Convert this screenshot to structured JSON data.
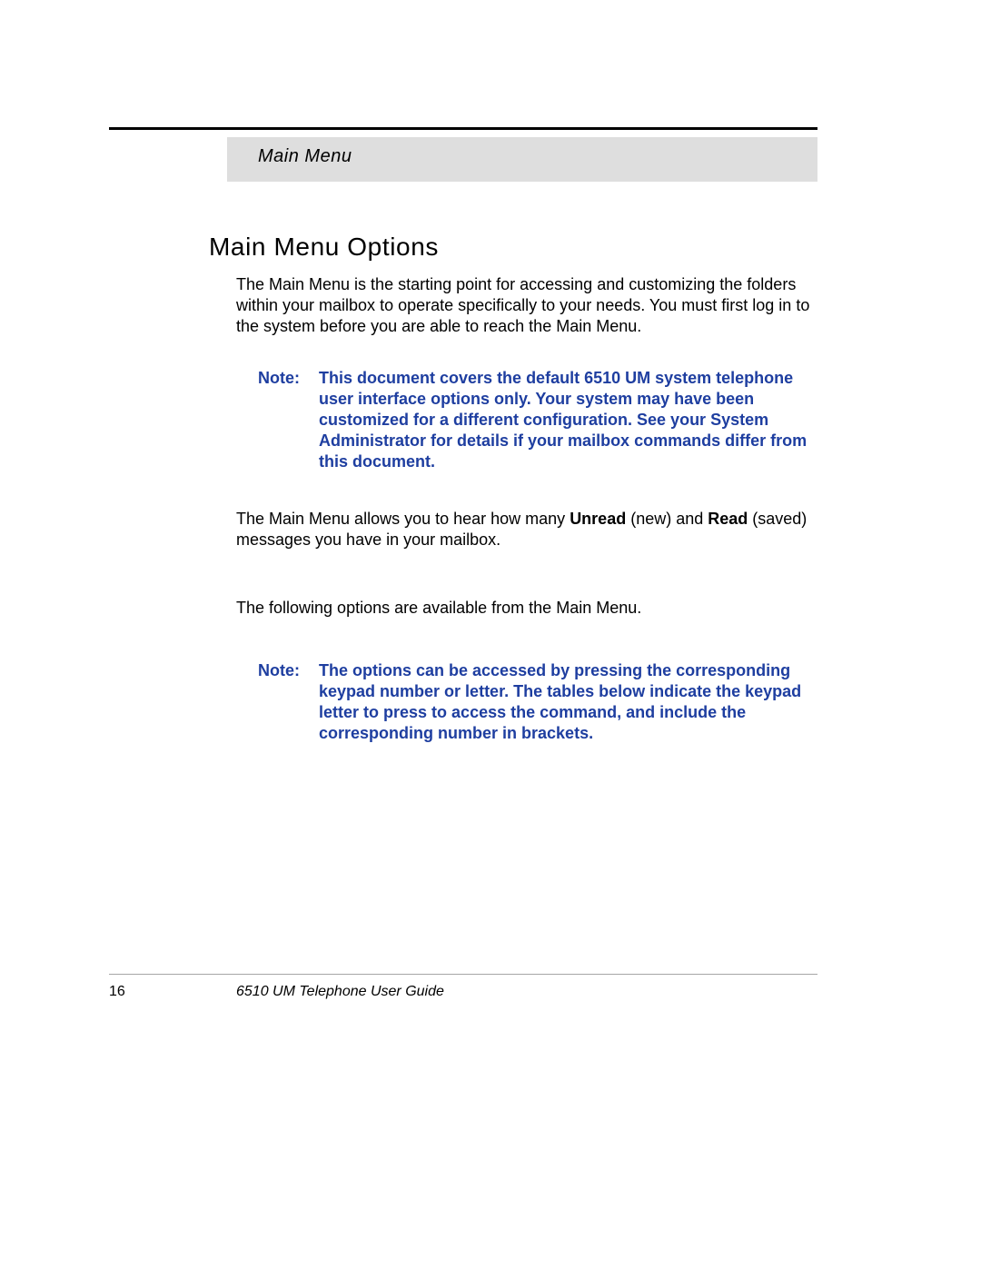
{
  "header": {
    "section_title": "Main Menu"
  },
  "main": {
    "heading": "Main Menu Options",
    "intro": "The Main Menu is the starting point for accessing and customizing the folders within your mailbox to operate specifically to your needs. You must first log in to the system before you are able to reach the Main Menu.",
    "note1": {
      "label": "Note:",
      "text": "This document covers the default 6510 UM system telephone user interface options only. Your system may have been customized for a different configuration. See your System Administrator for details if your mailbox commands differ from this document."
    },
    "para2_pre": "The Main Menu allows you to hear how many ",
    "para2_bold1": "Unread",
    "para2_mid1": " (new) and ",
    "para2_bold2": "Read",
    "para2_mid2": " (saved) messages you have in your mailbox.",
    "para3": "The following options are available from the Main Menu.",
    "note2": {
      "label": "Note:",
      "text": "The options can be accessed by pressing the corresponding keypad number or letter. The tables below indicate the keypad letter to press to access the command, and include the corresponding number in brackets."
    }
  },
  "footer": {
    "page_number": "16",
    "doc_title": "6510 UM Telephone User Guide"
  }
}
